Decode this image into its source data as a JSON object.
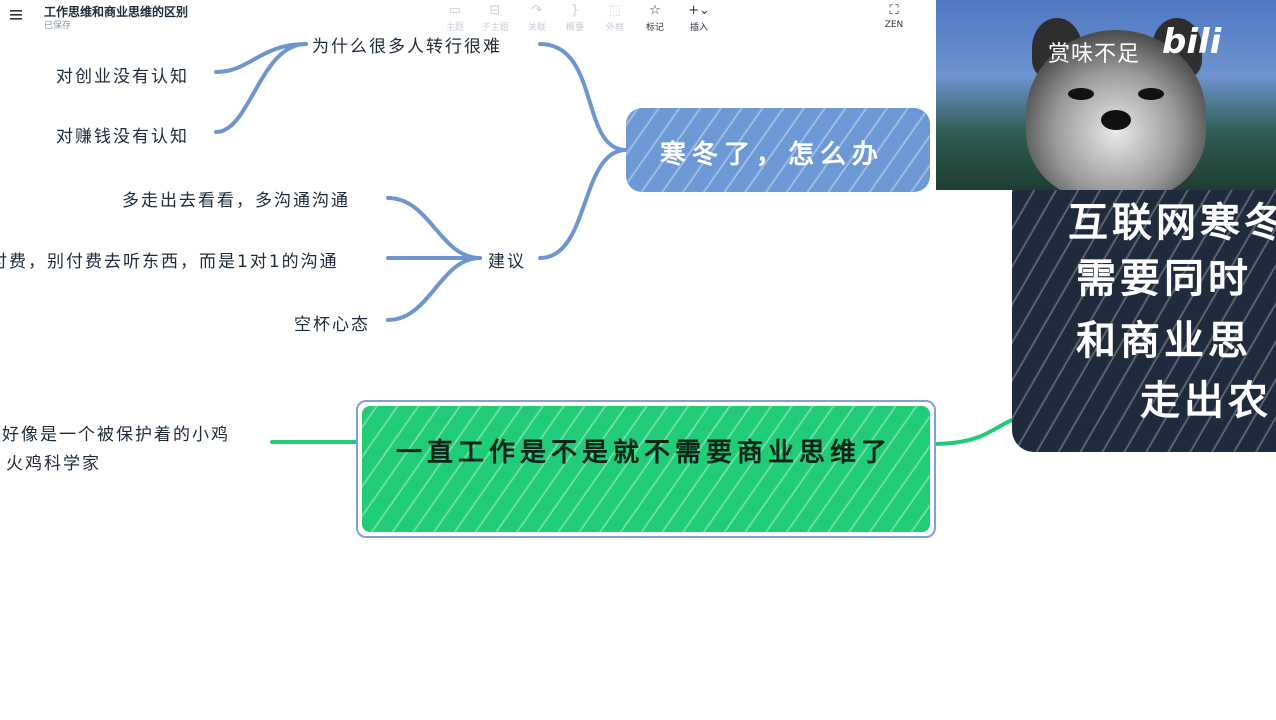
{
  "header": {
    "title": "工作思维和商业思维的区别",
    "status": "已保存",
    "menu_icon": "hamburger-menu-icon"
  },
  "toolbar": {
    "items": [
      {
        "label": "主题",
        "icon": "topic-icon"
      },
      {
        "label": "子主题",
        "icon": "subtopic-icon"
      },
      {
        "label": "关联",
        "icon": "relation-icon"
      },
      {
        "label": "概要",
        "icon": "summary-icon"
      },
      {
        "label": "外框",
        "icon": "boundary-icon"
      },
      {
        "label": "标记",
        "icon": "star-icon"
      },
      {
        "label": "插入",
        "icon": "plus-icon"
      }
    ],
    "zen_label": "ZEN"
  },
  "mindmap": {
    "left_nodes_top": [
      "为什么很多人转行很难",
      "对创业没有认知",
      "对赚钱没有认知"
    ],
    "advice_root": "建议",
    "advice_items": [
      "多走出去看看，多沟通沟通",
      "付费，别付费去听东西，而是1对1的沟通",
      "空杯心态"
    ],
    "winter_node": "寒冬了，怎么办",
    "work_node": "一直工作是不是就不需要商业思维了",
    "left_notes": [
      "好像是一个被保护着的小鸡",
      "火鸡科学家"
    ]
  },
  "side_panel": {
    "caption": "赏味不足",
    "logo": "bili",
    "card_lines": [
      "互联网寒冬",
      "需要同时",
      "和商业思",
      "走出农"
    ]
  },
  "colors": {
    "blue_node": "#6c99d6",
    "green_node": "#20cc78",
    "link_blue": "#6f95cf",
    "link_green": "#20cc78",
    "dark_card": "#1f2b3c"
  }
}
